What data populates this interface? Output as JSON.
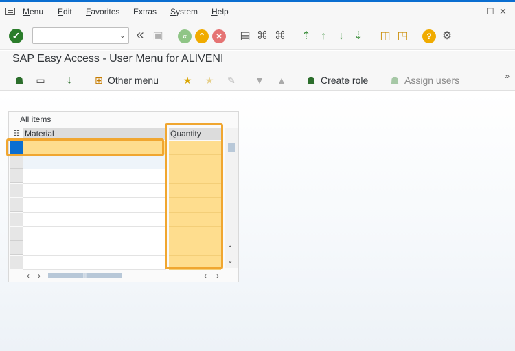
{
  "menubar": {
    "items": [
      {
        "u": "M",
        "rest": "enu"
      },
      {
        "u": "E",
        "rest": "dit"
      },
      {
        "u": "F",
        "rest": "avorites"
      },
      {
        "u": "",
        "rest": "Extras"
      },
      {
        "u": "S",
        "rest": "ystem"
      },
      {
        "u": "H",
        "rest": "elp"
      }
    ]
  },
  "toolbar": {
    "command_field_value": "",
    "ok_glyph": "✓"
  },
  "title": "SAP Easy Access  -  User Menu for ALIVENI",
  "app_toolbar": {
    "other_menu": "Other menu",
    "create_role": "Create role",
    "assign_users": "Assign users",
    "more": "»"
  },
  "table": {
    "title": "All items",
    "columns": [
      "Material",
      "Quantity"
    ],
    "rows": [
      "",
      "",
      "",
      "",
      "",
      "",
      "",
      "",
      ""
    ],
    "highlight_color": "#f0a630",
    "input_color": "#fedd8e"
  },
  "colors": {
    "ok_green": "#2b7d2b",
    "nav_green": "#6cb35e",
    "nav_orange": "#f0ab00",
    "cancel_red": "#e57373",
    "help_orange": "#f0ab00",
    "selected_row": "#0a6ed1"
  },
  "icons": [
    "back-icon",
    "save-icon",
    "exit-icon",
    "cancel-icon",
    "print-icon",
    "find-icon",
    "find-next-icon",
    "first-page-icon",
    "previous-page-icon",
    "next-page-icon",
    "last-page-icon",
    "create-session-icon",
    "shortcut-icon",
    "help-icon",
    "settings-icon"
  ]
}
